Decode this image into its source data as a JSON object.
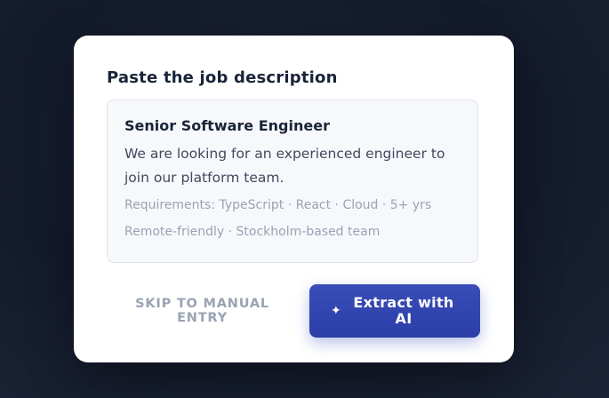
{
  "card": {
    "title": "Paste the job description"
  },
  "job_description": {
    "role": "Senior Software Engineer",
    "description": "We are looking for an experienced engineer to join our platform team.",
    "requirements": "Requirements: TypeScript · React · Cloud · 5+ yrs",
    "location": "Remote-friendly · Stockholm-based team"
  },
  "actions": {
    "skip_label": "SKIP TO MANUAL ENTRY",
    "extract_label": "Extract with AI",
    "extract_icon": "sparkle-icon"
  },
  "colors": {
    "primary": "#3a4db8",
    "muted_text": "#9aa3b2",
    "heading_text": "#1a2438",
    "background": "#131a2a"
  }
}
